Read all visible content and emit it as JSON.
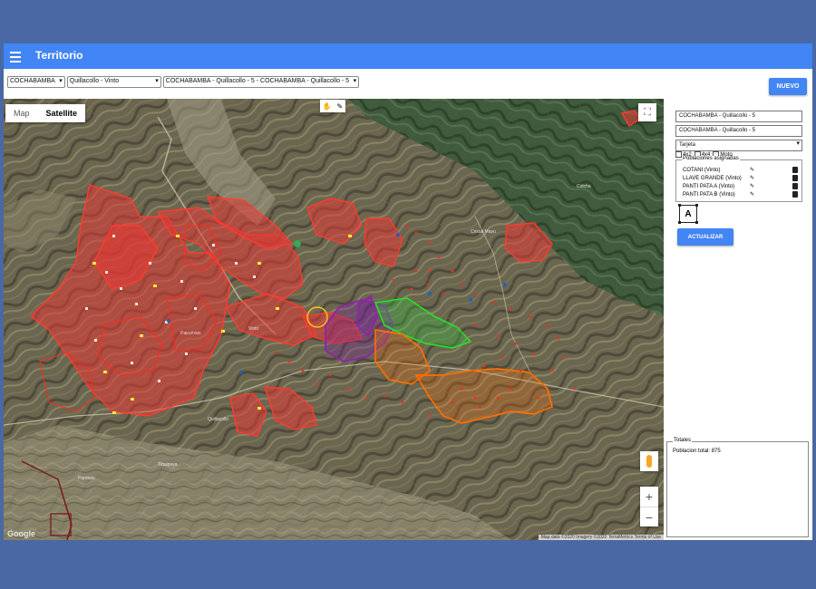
{
  "app": {
    "title": "Territorio"
  },
  "filters": {
    "departamento": "COCHABAMBA",
    "municipio": "Quillacollo - Vinto",
    "territorio": "COCHABAMBA - Quillacollo - 5 - COCHABAMBA - Quillacollo - 5"
  },
  "actions": {
    "nuevo": "NUEVO",
    "actualizar": "ACTUALIZAR"
  },
  "map": {
    "type_map": "Map",
    "type_satellite": "Satellite",
    "active_type": "Satellite",
    "attribution": "Map data ©2020 Imagery ©2020 TerraMetrics   Terms of Use",
    "logo": "Google",
    "zoom_in": "+",
    "zoom_out": "−",
    "place_labels": [
      "Pairumani",
      "Vinto",
      "Quillacollo",
      "Tiquipaya",
      "Cristal Mayu",
      "Colcha",
      "Parotani"
    ]
  },
  "panel": {
    "name_field": "COCHABAMBA - Quillacollo - 5",
    "name_field_2": "COCHABAMBA - Quillacollo - 5",
    "tipo": "Tarjeta",
    "vehicles": [
      "4x2",
      "4x4",
      "Moto"
    ],
    "poblaciones_legend": "Poblaciones asignadas",
    "poblaciones": [
      "COTANI (Vinto)",
      "LLAVE GRANDE (Vinto)",
      "PANTI PATA A (Vinto)",
      "PANTI PATA B (Vinto)"
    ],
    "label_tool": "A"
  },
  "totales": {
    "legend": "Totales",
    "text": "Poblacion total: 875"
  },
  "colors": {
    "accent": "#4285f4",
    "zone_red": "#e53935",
    "zone_purple": "#7b1fa2",
    "zone_orange": "#ff6d00",
    "zone_green": "#2ecc40"
  }
}
